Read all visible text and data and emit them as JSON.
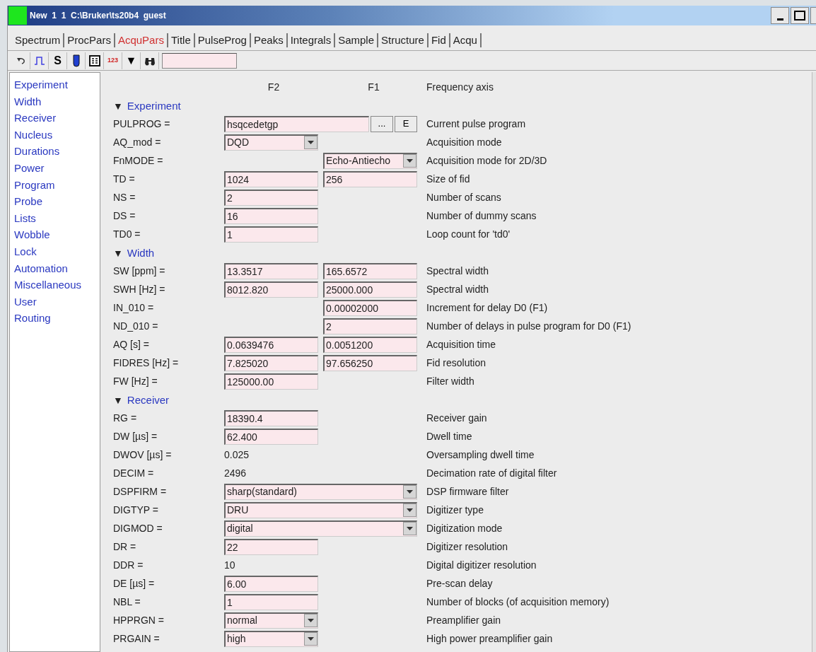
{
  "window": {
    "title": "New  1  1  C:\\Bruker\\ts20b4  guest"
  },
  "tabs": [
    {
      "label": "Spectrum",
      "selected": false
    },
    {
      "label": "ProcPars",
      "selected": false
    },
    {
      "label": "AcquPars",
      "selected": true
    },
    {
      "label": "Title",
      "selected": false
    },
    {
      "label": "PulseProg",
      "selected": false
    },
    {
      "label": "Peaks",
      "selected": false
    },
    {
      "label": "Integrals",
      "selected": false
    },
    {
      "label": "Sample",
      "selected": false
    },
    {
      "label": "Structure",
      "selected": false
    },
    {
      "label": "Fid",
      "selected": false
    },
    {
      "label": "Acqu",
      "selected": false
    }
  ],
  "toolbar": {
    "letter_button": "S",
    "numbers_button": "123",
    "dropdown_button": "▼"
  },
  "sidebar": {
    "items": [
      "Experiment",
      "Width",
      "Receiver",
      "Nucleus",
      "Durations",
      "Power",
      "Program",
      "Probe",
      "Lists",
      "Wobble",
      "Lock",
      "Automation",
      "Miscellaneous",
      "User",
      "Routing"
    ]
  },
  "table": {
    "columns": [
      "F2",
      "F1",
      "Frequency axis"
    ],
    "rows": [
      {
        "kind": "section",
        "toggle": "▼",
        "title": "Experiment"
      },
      {
        "kind": "param",
        "label": "PULPROG =",
        "f2": {
          "kind": "program",
          "value": "hsqcedetgp",
          "buttons": [
            "...",
            "E"
          ]
        },
        "description": "Current pulse program"
      },
      {
        "kind": "param",
        "label": "AQ_mod =",
        "f2": {
          "kind": "select",
          "value": "DQD"
        },
        "description": "Acquisition mode"
      },
      {
        "kind": "param",
        "label": "FnMODE =",
        "f1": {
          "kind": "select",
          "value": "Echo-Antiecho"
        },
        "description": "Acquisition mode for 2D/3D"
      },
      {
        "kind": "param",
        "label": "TD =",
        "f2": {
          "kind": "input",
          "value": "1024"
        },
        "f1": {
          "kind": "input",
          "value": "256"
        },
        "description": "Size of fid"
      },
      {
        "kind": "param",
        "label": "NS =",
        "f2": {
          "kind": "input",
          "value": "2"
        },
        "description": "Number of scans"
      },
      {
        "kind": "param",
        "label": "DS =",
        "f2": {
          "kind": "input",
          "value": "16"
        },
        "description": "Number of dummy scans"
      },
      {
        "kind": "param",
        "label": "TD0 =",
        "f2": {
          "kind": "input",
          "value": "1"
        },
        "description": "Loop count for 'td0'"
      },
      {
        "kind": "section",
        "toggle": "▼",
        "title": "Width"
      },
      {
        "kind": "param",
        "label": "SW [ppm] =",
        "f2": {
          "kind": "input",
          "value": "13.3517"
        },
        "f1": {
          "kind": "input",
          "value": "165.6572"
        },
        "description": "Spectral width"
      },
      {
        "kind": "param",
        "label": "SWH [Hz] =",
        "f2": {
          "kind": "input",
          "value": "8012.820"
        },
        "f1": {
          "kind": "input",
          "value": "25000.000"
        },
        "description": "Spectral width"
      },
      {
        "kind": "param",
        "label": "IN_010 =",
        "f1": {
          "kind": "input",
          "value": "0.00002000"
        },
        "description": "Increment for delay D0 (F1)"
      },
      {
        "kind": "param",
        "label": "ND_010 =",
        "f1": {
          "kind": "input",
          "value": "2"
        },
        "description": "Number of delays in pulse program for D0 (F1)"
      },
      {
        "kind": "param",
        "label": "AQ [s] =",
        "f2": {
          "kind": "input",
          "value": "0.0639476"
        },
        "f1": {
          "kind": "input",
          "value": "0.0051200"
        },
        "description": "Acquisition time"
      },
      {
        "kind": "param",
        "label": "FIDRES [Hz] =",
        "f2": {
          "kind": "input",
          "value": "7.825020"
        },
        "f1": {
          "kind": "input",
          "value": "97.656250"
        },
        "description": "Fid resolution"
      },
      {
        "kind": "param",
        "label": "FW [Hz] =",
        "f2": {
          "kind": "input",
          "value": "125000.00"
        },
        "description": "Filter width"
      },
      {
        "kind": "section",
        "toggle": "▼",
        "title": "Receiver"
      },
      {
        "kind": "param",
        "label": "RG =",
        "f2": {
          "kind": "input",
          "value": "18390.4"
        },
        "description": "Receiver gain"
      },
      {
        "kind": "param",
        "label": "DW [µs] =",
        "f2": {
          "kind": "input",
          "value": "62.400"
        },
        "description": "Dwell time"
      },
      {
        "kind": "param",
        "label": "DWOV [µs] =",
        "f2": {
          "kind": "plain",
          "value": "0.025"
        },
        "description": "Oversampling dwell time"
      },
      {
        "kind": "param",
        "label": "DECIM =",
        "f2": {
          "kind": "plain",
          "value": "2496"
        },
        "description": "Decimation rate of digital filter"
      },
      {
        "kind": "param",
        "label": "DSPFIRM =",
        "f2": {
          "kind": "wide_select",
          "value": "sharp(standard)"
        },
        "description": "DSP firmware filter"
      },
      {
        "kind": "param",
        "label": "DIGTYP =",
        "f2": {
          "kind": "wide_select",
          "value": "DRU"
        },
        "description": "Digitizer type"
      },
      {
        "kind": "param",
        "label": "DIGMOD =",
        "f2": {
          "kind": "wide_select",
          "value": "digital"
        },
        "description": "Digitization mode"
      },
      {
        "kind": "param",
        "label": "DR =",
        "f2": {
          "kind": "input",
          "value": "22"
        },
        "description": "Digitizer resolution"
      },
      {
        "kind": "param",
        "label": "DDR =",
        "f2": {
          "kind": "plain",
          "value": "10"
        },
        "description": "Digital digitizer resolution"
      },
      {
        "kind": "param",
        "label": "DE [µs] =",
        "f2": {
          "kind": "input",
          "value": "6.00"
        },
        "description": "Pre-scan delay"
      },
      {
        "kind": "param",
        "label": "NBL =",
        "f2": {
          "kind": "input",
          "value": "1"
        },
        "description": "Number of blocks (of acquisition memory)"
      },
      {
        "kind": "param",
        "label": "HPPRGN =",
        "f2": {
          "kind": "select",
          "value": "normal"
        },
        "description": "Preamplifier gain"
      },
      {
        "kind": "param",
        "label": "PRGAIN =",
        "f2": {
          "kind": "select",
          "value": "high"
        },
        "description": "High power preamplifier gain"
      }
    ]
  }
}
